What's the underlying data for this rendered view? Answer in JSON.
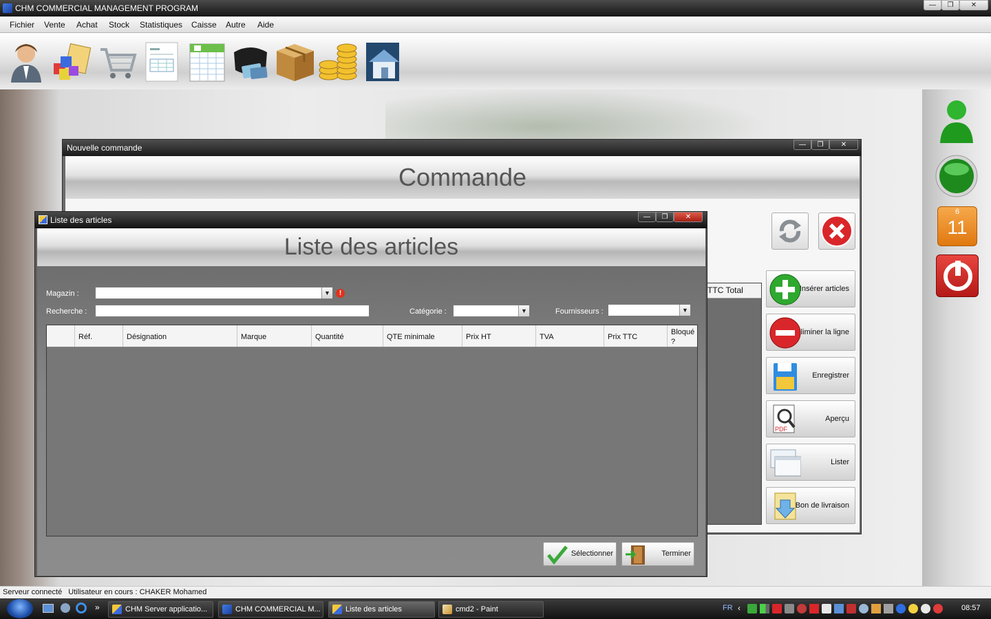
{
  "app": {
    "title": "CHM COMMERCIAL MANAGEMENT PROGRAM",
    "window_controls": {
      "minimize": "—",
      "restore": "❐",
      "close": "✕"
    }
  },
  "menu": [
    "Fichier",
    "Vente",
    "Achat",
    "Stock",
    "Statistiques",
    "Caisse",
    "Autre",
    "Aide"
  ],
  "toolbar": {
    "icons": [
      "user-icon",
      "products-icon",
      "cart-icon",
      "invoice-icon",
      "spreadsheet-icon",
      "wallet-icon",
      "box-icon",
      "coins-icon",
      "house-icon"
    ]
  },
  "order_window": {
    "title": "Nouvelle commande",
    "header": "Commande",
    "grid_column": "TTC Total",
    "buttons": {
      "insert": "Insérer articles",
      "remove": "Eliminer la ligne",
      "save": "Enregistrer",
      "preview": "Aperçu",
      "list": "Lister",
      "delivery": "Bon de livraison"
    }
  },
  "articles_window": {
    "title": "Liste des articles",
    "header": "Liste des articles",
    "labels": {
      "store": "Magazin :",
      "search": "Recherche :",
      "category": "Catégorie :",
      "suppliers": "Fournisseurs :"
    },
    "values": {
      "store": "",
      "search": "",
      "category": "",
      "suppliers": ""
    },
    "columns": [
      "",
      "Réf.",
      "Désignation",
      "Marque",
      "Quantité",
      "QTE minimale",
      "Prix HT",
      "TVA",
      "Prix TTC",
      "Bloqué ?"
    ],
    "rows": [],
    "buttons": {
      "select": "Sélectionner",
      "finish": "Terminer"
    }
  },
  "side_panel": {
    "calendar_month": "6",
    "calendar_day": "11"
  },
  "status": {
    "server": "Serveur connecté",
    "user": "Utilisateur en cours : CHAKER Mohamed"
  },
  "taskbar": {
    "tasks": [
      "CHM Server applicatio...",
      "CHM COMMERCIAL M...",
      "Liste des articles",
      "cmd2 - Paint"
    ],
    "language": "FR",
    "clock": "08:57"
  },
  "colors": {
    "accent_green": "#2fa82f",
    "danger_red": "#d9262a",
    "calendar_orange": "#f08a1c"
  }
}
